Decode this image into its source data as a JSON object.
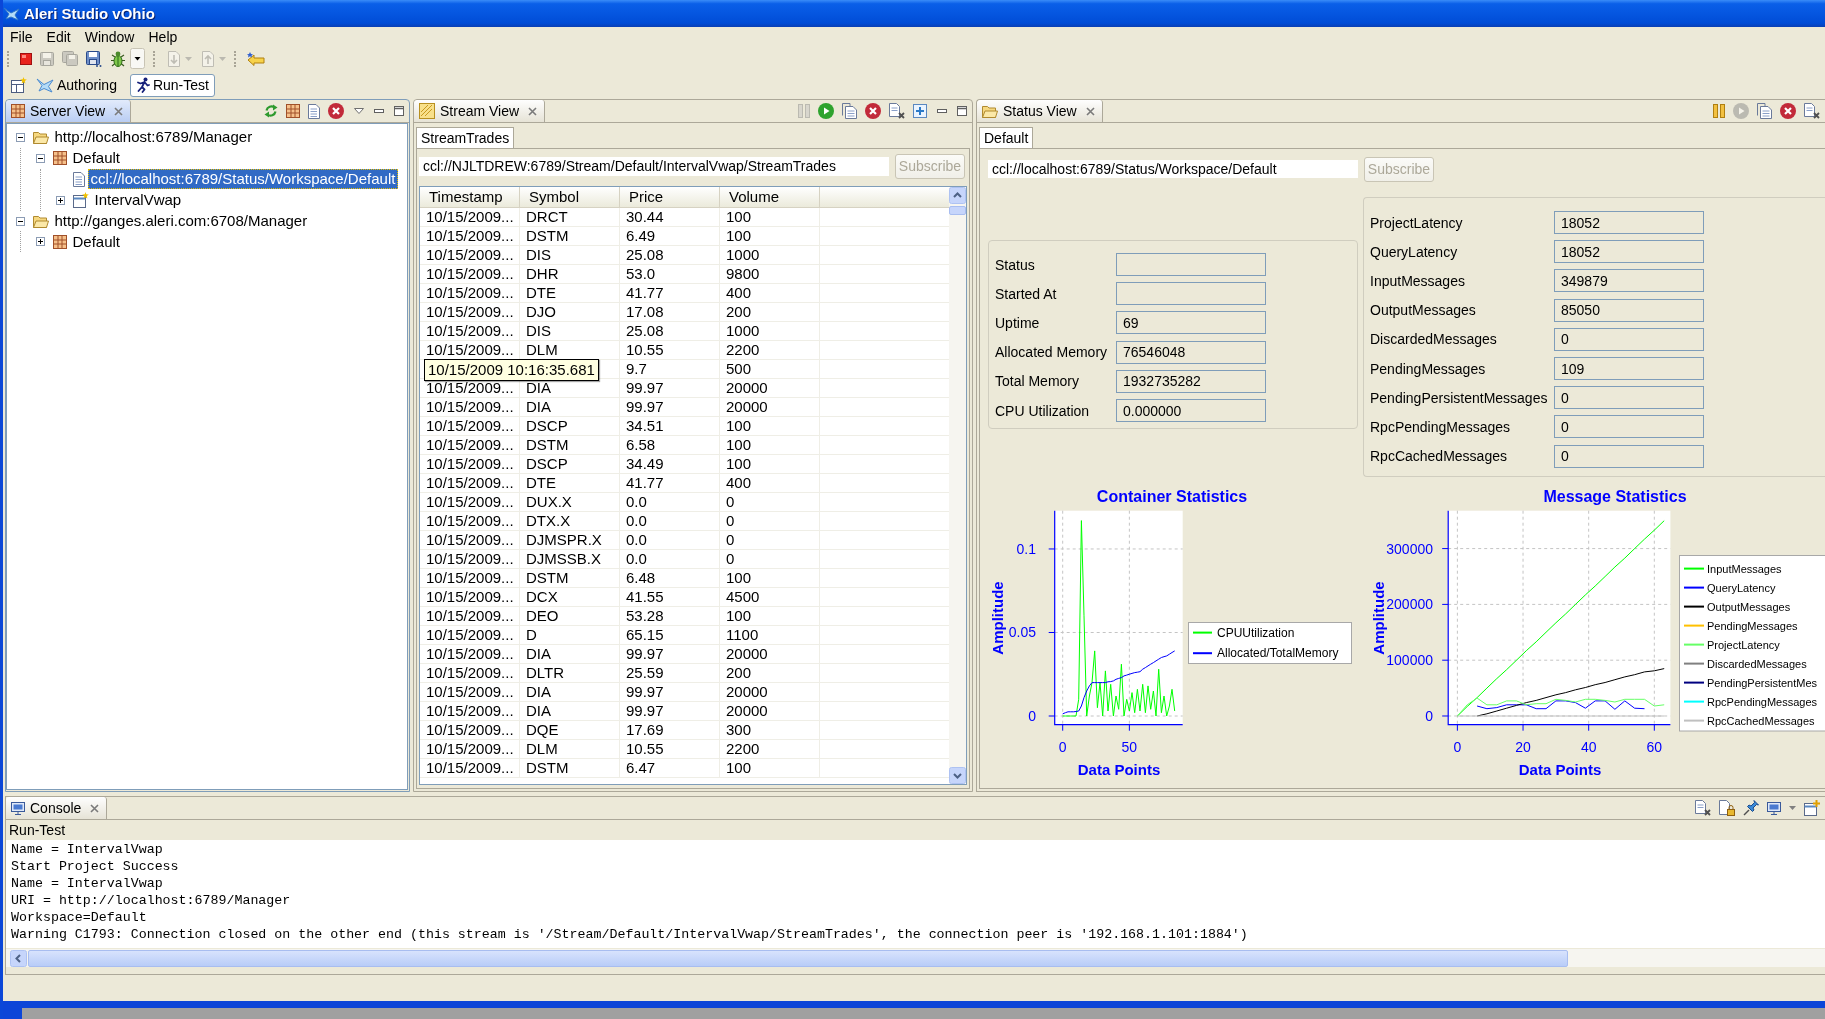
{
  "window": {
    "title": "Aleri Studio vOhio"
  },
  "menu": [
    "File",
    "Edit",
    "Window",
    "Help"
  ],
  "toolbar": [
    [
      {
        "kind": "stop",
        "disabled": false,
        "dropdown": false
      },
      {
        "kind": "save",
        "disabled": true,
        "dropdown": false
      },
      {
        "kind": "save_all",
        "disabled": true,
        "dropdown": false
      },
      {
        "kind": "save_as",
        "disabled": false,
        "dropdown": false
      },
      {
        "kind": "debug",
        "disabled": false,
        "dropdown": true
      }
    ],
    [
      {
        "kind": "import",
        "disabled": true,
        "dropdown": true
      },
      {
        "kind": "export",
        "disabled": true,
        "dropdown": true
      }
    ],
    [
      {
        "kind": "back",
        "disabled": false,
        "dropdown": false
      }
    ]
  ],
  "perspectives": [
    {
      "kind": "authoring",
      "label": "Authoring",
      "selected": false
    },
    {
      "kind": "runtest",
      "label": "Run-Test",
      "selected": true
    }
  ],
  "views": [
    {
      "kind": "server",
      "title": "Server View",
      "active": true,
      "actions": [
        {
          "kind": "refresh",
          "disabled": false
        },
        {
          "kind": "grid",
          "disabled": false
        },
        {
          "kind": "document",
          "disabled": false
        },
        {
          "kind": "remove",
          "disabled": false
        }
      ],
      "tree": [
        {
          "kind": "folder",
          "label": "http://localhost:6789/Manager",
          "expanded": true,
          "selected": false,
          "children": [
            {
              "kind": "workspace",
              "label": "Default",
              "expanded": true,
              "selected": false,
              "children": [
                {
                  "kind": "document",
                  "label": "ccl://localhost:6789/Status/Workspace/Default",
                  "selected": true
                },
                {
                  "kind": "project",
                  "label": "IntervalVwap",
                  "expanded": false,
                  "selected": false
                }
              ]
            }
          ]
        },
        {
          "kind": "folder",
          "label": "http://ganges.aleri.com:6708/Manager",
          "expanded": true,
          "selected": false,
          "children": [
            {
              "kind": "workspace",
              "label": "Default",
              "expanded": false,
              "selected": false
            }
          ]
        }
      ]
    },
    {
      "kind": "stream",
      "title": "Stream View",
      "active": false,
      "actions": [
        {
          "kind": "pause",
          "disabled": true
        },
        {
          "kind": "play",
          "disabled": false
        },
        {
          "kind": "copy",
          "disabled": false
        },
        {
          "kind": "remove",
          "disabled": false
        },
        {
          "kind": "clear",
          "disabled": false
        },
        {
          "kind": "add",
          "disabled": false
        }
      ],
      "tabs": [
        {
          "label": "StreamTrades",
          "selected": true
        }
      ],
      "address": {
        "value": "ccl://NJLTDREW:6789/Stream/Default/IntervalVwap/StreamTrades"
      },
      "subscribe": {
        "label": "Subscribe",
        "disabled": true
      },
      "table": {
        "columns": [
          "Timestamp",
          "Symbol",
          "Price",
          "Volume"
        ],
        "rows": [
          {
            "timestamp": "10/15/2009...",
            "symbol": "DRCT",
            "price": "30.44",
            "volume": "100"
          },
          {
            "timestamp": "10/15/2009...",
            "symbol": "DSTM",
            "price": "6.49",
            "volume": "100"
          },
          {
            "timestamp": "10/15/2009...",
            "symbol": "DIS",
            "price": "25.08",
            "volume": "1000"
          },
          {
            "timestamp": "10/15/2009...",
            "symbol": "DHR",
            "price": "53.0",
            "volume": "9800"
          },
          {
            "timestamp": "10/15/2009...",
            "symbol": "DTE",
            "price": "41.77",
            "volume": "400"
          },
          {
            "timestamp": "10/15/2009...",
            "symbol": "DJO",
            "price": "17.08",
            "volume": "200"
          },
          {
            "timestamp": "10/15/2009...",
            "symbol": "DIS",
            "price": "25.08",
            "volume": "1000"
          },
          {
            "timestamp": "10/15/2009...",
            "symbol": "DLM",
            "price": "10.55",
            "volume": "2200"
          },
          {
            "price": "9.7",
            "volume": "500",
            "tooltip": "10/15/2009 10:16:35.681"
          },
          {
            "timestamp": "10/15/2009...",
            "symbol": "DIA",
            "price": "99.97",
            "volume": "20000"
          },
          {
            "timestamp": "10/15/2009...",
            "symbol": "DIA",
            "price": "99.97",
            "volume": "20000"
          },
          {
            "timestamp": "10/15/2009...",
            "symbol": "DSCP",
            "price": "34.51",
            "volume": "100"
          },
          {
            "timestamp": "10/15/2009...",
            "symbol": "DSTM",
            "price": "6.58",
            "volume": "100"
          },
          {
            "timestamp": "10/15/2009...",
            "symbol": "DSCP",
            "price": "34.49",
            "volume": "100"
          },
          {
            "timestamp": "10/15/2009...",
            "symbol": "DTE",
            "price": "41.77",
            "volume": "400"
          },
          {
            "timestamp": "10/15/2009...",
            "symbol": "DUX.X",
            "price": "0.0",
            "volume": "0"
          },
          {
            "timestamp": "10/15/2009...",
            "symbol": "DTX.X",
            "price": "0.0",
            "volume": "0"
          },
          {
            "timestamp": "10/15/2009...",
            "symbol": "DJMSPR.X",
            "price": "0.0",
            "volume": "0"
          },
          {
            "timestamp": "10/15/2009...",
            "symbol": "DJMSSB.X",
            "price": "0.0",
            "volume": "0"
          },
          {
            "timestamp": "10/15/2009...",
            "symbol": "DSTM",
            "price": "6.48",
            "volume": "100"
          },
          {
            "timestamp": "10/15/2009...",
            "symbol": "DCX",
            "price": "41.55",
            "volume": "4500"
          },
          {
            "timestamp": "10/15/2009...",
            "symbol": "DEO",
            "price": "53.28",
            "volume": "100"
          },
          {
            "timestamp": "10/15/2009...",
            "symbol": "D",
            "price": "65.15",
            "volume": "1100"
          },
          {
            "timestamp": "10/15/2009...",
            "symbol": "DIA",
            "price": "99.97",
            "volume": "20000"
          },
          {
            "timestamp": "10/15/2009...",
            "symbol": "DLTR",
            "price": "25.59",
            "volume": "200"
          },
          {
            "timestamp": "10/15/2009...",
            "symbol": "DIA",
            "price": "99.97",
            "volume": "20000"
          },
          {
            "timestamp": "10/15/2009...",
            "symbol": "DIA",
            "price": "99.97",
            "volume": "20000"
          },
          {
            "timestamp": "10/15/2009...",
            "symbol": "DQE",
            "price": "17.69",
            "volume": "300"
          },
          {
            "timestamp": "10/15/2009...",
            "symbol": "DLM",
            "price": "10.55",
            "volume": "2200"
          },
          {
            "timestamp": "10/15/2009...",
            "symbol": "DSTM",
            "price": "6.47",
            "volume": "100"
          }
        ]
      }
    },
    {
      "kind": "status",
      "title": "Status View",
      "active": false,
      "actions": [
        {
          "kind": "pause",
          "disabled": false
        },
        {
          "kind": "play",
          "disabled": true
        },
        {
          "kind": "copy",
          "disabled": false
        },
        {
          "kind": "remove",
          "disabled": false
        },
        {
          "kind": "clear",
          "disabled": false
        }
      ],
      "tabs": [
        {
          "label": "Default",
          "selected": true
        }
      ],
      "address": {
        "value": "ccl://localhost:6789/Status/Workspace/Default"
      },
      "subscribe": {
        "label": "Subscribe",
        "disabled": true
      },
      "container_fields": [
        {
          "label": "Status"
        },
        {
          "label": "Started At"
        },
        {
          "label": "Uptime",
          "value": "69"
        },
        {
          "label": "Allocated Memory",
          "value": "76546048"
        },
        {
          "label": "Total Memory",
          "value": "1932735282"
        },
        {
          "label": "CPU Utilization",
          "value": "0.000000"
        }
      ],
      "message_fields": [
        {
          "label": "ProjectLatency",
          "value": "18052"
        },
        {
          "label": "QueryLatency",
          "value": "18052"
        },
        {
          "label": "InputMessages",
          "value": "349879"
        },
        {
          "label": "OutputMessages",
          "value": "85050"
        },
        {
          "label": "DiscardedMessages",
          "value": "0"
        },
        {
          "label": "PendingMessages",
          "value": "109"
        },
        {
          "label": "PendingPersistentMessages",
          "value": "0"
        },
        {
          "label": "RpcPendingMessages",
          "value": "0"
        },
        {
          "label": "RpcCachedMessages",
          "value": "0"
        }
      ],
      "charts": [
        {
          "chart_data": {
            "type": "line",
            "title": "Container Statistics",
            "xlabel": "Data Points",
            "ylabel": "Amplitude",
            "x": [
              0,
              2,
              4,
              6,
              8,
              10,
              12,
              14,
              16,
              18,
              20,
              22,
              24,
              26,
              28,
              30,
              32,
              34,
              36,
              38,
              40,
              42,
              44,
              46,
              48,
              50,
              52,
              54,
              56,
              58,
              60,
              62,
              64,
              66,
              68,
              70,
              72,
              74,
              76,
              78,
              80,
              82,
              84
            ],
            "series": [
              {
                "name": "CPUUtilization",
                "color": "#00ff00",
                "values": [
                  0,
                  0,
                  0,
                  0,
                  0,
                  0,
                  0.01,
                  0.117,
                  0.06,
                  0,
                  0.012,
                  0.02,
                  0.039,
                  0.005,
                  0.02,
                  0,
                  0.027,
                  0.003,
                  0.019,
                  0,
                  0.012,
                  0.004,
                  0.031,
                  0,
                  0.01,
                  0.003,
                  0.014,
                  0.002,
                  0.016,
                  0.003,
                  0.019,
                  0.002,
                  0.018,
                  0.004,
                  0.015,
                  0,
                  0.028,
                  0.002,
                  0.012,
                  0,
                  0.006,
                  0.016,
                  0.003
                ]
              },
              {
                "name": "Allocated/TotalMemory",
                "color": "#0000ff",
                "values": [
                  0.0013,
                  0.002,
                  0.0025,
                  0.0025,
                  0.0025,
                  0.0027,
                  0.003,
                  0.006,
                  0.011,
                  0.015,
                  0.018,
                  0.02,
                  0.02,
                  0.02,
                  0.02,
                  0.02,
                  0.02,
                  0.0205,
                  0.0206,
                  0.021,
                  0.022,
                  0.0225,
                  0.023,
                  0.024,
                  0.0245,
                  0.025,
                  0.0255,
                  0.026,
                  0.0262,
                  0.0265,
                  0.028,
                  0.029,
                  0.03,
                  0.031,
                  0.032,
                  0.033,
                  0.034,
                  0.035,
                  0.0355,
                  0.036,
                  0.037,
                  0.038,
                  0.039
                ]
              }
            ],
            "xlim": [
              -6,
              90
            ],
            "ylim": [
              -0.0052,
              0.1229
            ],
            "xticks": [
              0,
              50
            ],
            "yticks": [
              0,
              0.05,
              0.1
            ],
            "grid": true,
            "legend": "right"
          }
        },
        {
          "chart_data": {
            "type": "line",
            "title": "Message Statistics",
            "xlabel": "Data Points",
            "ylabel": "Amplitude",
            "x": [
              0,
              3,
              6,
              9,
              12,
              15,
              18,
              21,
              24,
              27,
              30,
              33,
              36,
              39,
              42,
              45,
              48,
              51,
              54,
              57,
              60,
              63
            ],
            "series": [
              {
                "name": "InputMessages",
                "color": "#00ff00",
                "values": [
                  0,
                  17000,
                  33000,
                  50000,
                  67000,
                  83000,
                  100000,
                  117000,
                  133000,
                  150000,
                  167000,
                  183000,
                  200000,
                  217000,
                  233000,
                  250000,
                  267000,
                  283000,
                  300000,
                  317000,
                  333000,
                  350000
                ]
              },
              {
                "name": "QueryLatency",
                "color": "#0000ff",
                "values": [
                  null,
                  null,
                  18000,
                  13000,
                  15000,
                  20000,
                  20000,
                  20000,
                  13000,
                  13000,
                  27000,
                  27000,
                  24000,
                  14000,
                  27000,
                  27000,
                  12000,
                  27000,
                  14000,
                  13000,
                  null,
                  null
                ]
              },
              {
                "name": "OutputMessages",
                "color": "#000000",
                "values": [
                  null,
                  null,
                  0,
                  4000,
                  9000,
                  14000,
                  19000,
                  24000,
                  28000,
                  33000,
                  38000,
                  42000,
                  47000,
                  51000,
                  56000,
                  60000,
                  65000,
                  70000,
                  74000,
                  79000,
                  81000,
                  85000
                ]
              },
              {
                "name": "PendingMessages",
                "color": "#ffc000",
                "values": [
                  null,
                  null,
                  null,
                  null,
                  null,
                  null,
                  null,
                  null,
                  null,
                  null,
                  null,
                  null,
                  null,
                  null,
                  null,
                  null,
                  null,
                  null,
                  null,
                  null,
                  null,
                  null
                ]
              },
              {
                "name": "ProjectLatency",
                "color": "#66ff66",
                "values": [
                  0,
                  20000,
                  32000,
                  20000,
                  20000,
                  27000,
                  27000,
                  20000,
                  22000,
                  22000,
                  30000,
                  28000,
                  25000,
                  30000,
                  30000,
                  28000,
                  25000,
                  30000,
                  30000,
                  30000,
                  18000,
                  20000
                ]
              },
              {
                "name": "DiscardedMessages",
                "color": "#808080",
                "values": [
                  null,
                  null,
                  null,
                  null,
                  null,
                  null,
                  null,
                  null,
                  null,
                  null,
                  null,
                  null,
                  null,
                  null,
                  null,
                  null,
                  null,
                  null,
                  null,
                  null,
                  null,
                  null
                ]
              },
              {
                "name": "PendingPersistentMes",
                "color": "#000080",
                "values": [
                  null,
                  null,
                  null,
                  null,
                  null,
                  null,
                  null,
                  null,
                  null,
                  null,
                  null,
                  null,
                  null,
                  null,
                  null,
                  null,
                  null,
                  null,
                  null,
                  null,
                  null,
                  null
                ]
              },
              {
                "name": "RpcPendingMessages",
                "color": "#00ffff",
                "values": [
                  null,
                  null,
                  null,
                  null,
                  null,
                  null,
                  null,
                  null,
                  null,
                  null,
                  null,
                  null,
                  null,
                  null,
                  null,
                  null,
                  null,
                  null,
                  null,
                  null,
                  null,
                  null
                ]
              },
              {
                "name": "RpcCachedMessages",
                "color": "#c0c0c0",
                "values": [
                  0,
                  0,
                  0,
                  0,
                  0,
                  0,
                  0,
                  0,
                  0,
                  0,
                  0,
                  0,
                  0,
                  0,
                  0,
                  0,
                  0,
                  0,
                  0,
                  0,
                  0,
                  0
                ]
              }
            ],
            "xlim": [
              -2.8,
              64.9
            ],
            "ylim": [
              -15600,
              367900
            ],
            "xticks": [
              0,
              20,
              40,
              60
            ],
            "yticks": [
              0,
              100000,
              200000,
              300000
            ],
            "grid": true,
            "legend": "right"
          }
        }
      ]
    }
  ],
  "console": {
    "title": "Console",
    "active": false,
    "actions": [
      {
        "kind": "clear",
        "dropdown": false
      },
      {
        "kind": "lock",
        "dropdown": false
      },
      {
        "kind": "pin",
        "dropdown": false
      },
      {
        "kind": "display",
        "dropdown": true
      },
      {
        "kind": "open",
        "dropdown": false
      }
    ],
    "label": "Run-Test",
    "lines": [
      "Name = IntervalVwap",
      "Start Project Success",
      "Name = IntervalVwap",
      "URI = http://localhost:6789/Manager",
      "Workspace=Default",
      "Warning C1793: Connection closed on the other end (this stream is '/Stream/Default/IntervalVwap/StreamTrades', the connection peer is '192.168.1.101:1884')"
    ]
  }
}
